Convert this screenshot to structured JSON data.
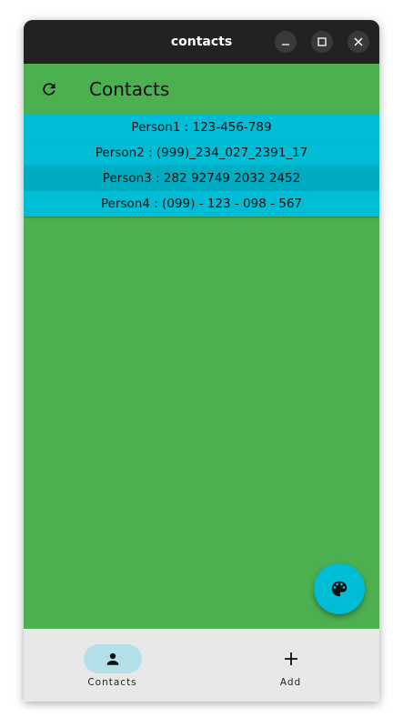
{
  "window": {
    "title": "contacts"
  },
  "appbar": {
    "title": "Contacts",
    "refresh_icon": "refresh-icon"
  },
  "contacts": [
    "Person1 : 123-456-789",
    "Person2 : (999)_234_027_2391_17",
    "Person3 : 282 92749 2032 2452",
    "Person4 : (099) - 123 - 098 - 567"
  ],
  "fab": {
    "icon": "palette-icon"
  },
  "navbar": {
    "items": [
      {
        "label": "Contacts",
        "icon": "person-icon",
        "selected": true
      },
      {
        "label": "Add",
        "icon": "plus-icon",
        "selected": false
      }
    ]
  },
  "colors": {
    "background": "#4caf50",
    "accent": "#00bcd4",
    "titlebar": "#222222",
    "navbar": "#e8e8e8",
    "nav_indicator": "#b2dfe8"
  }
}
